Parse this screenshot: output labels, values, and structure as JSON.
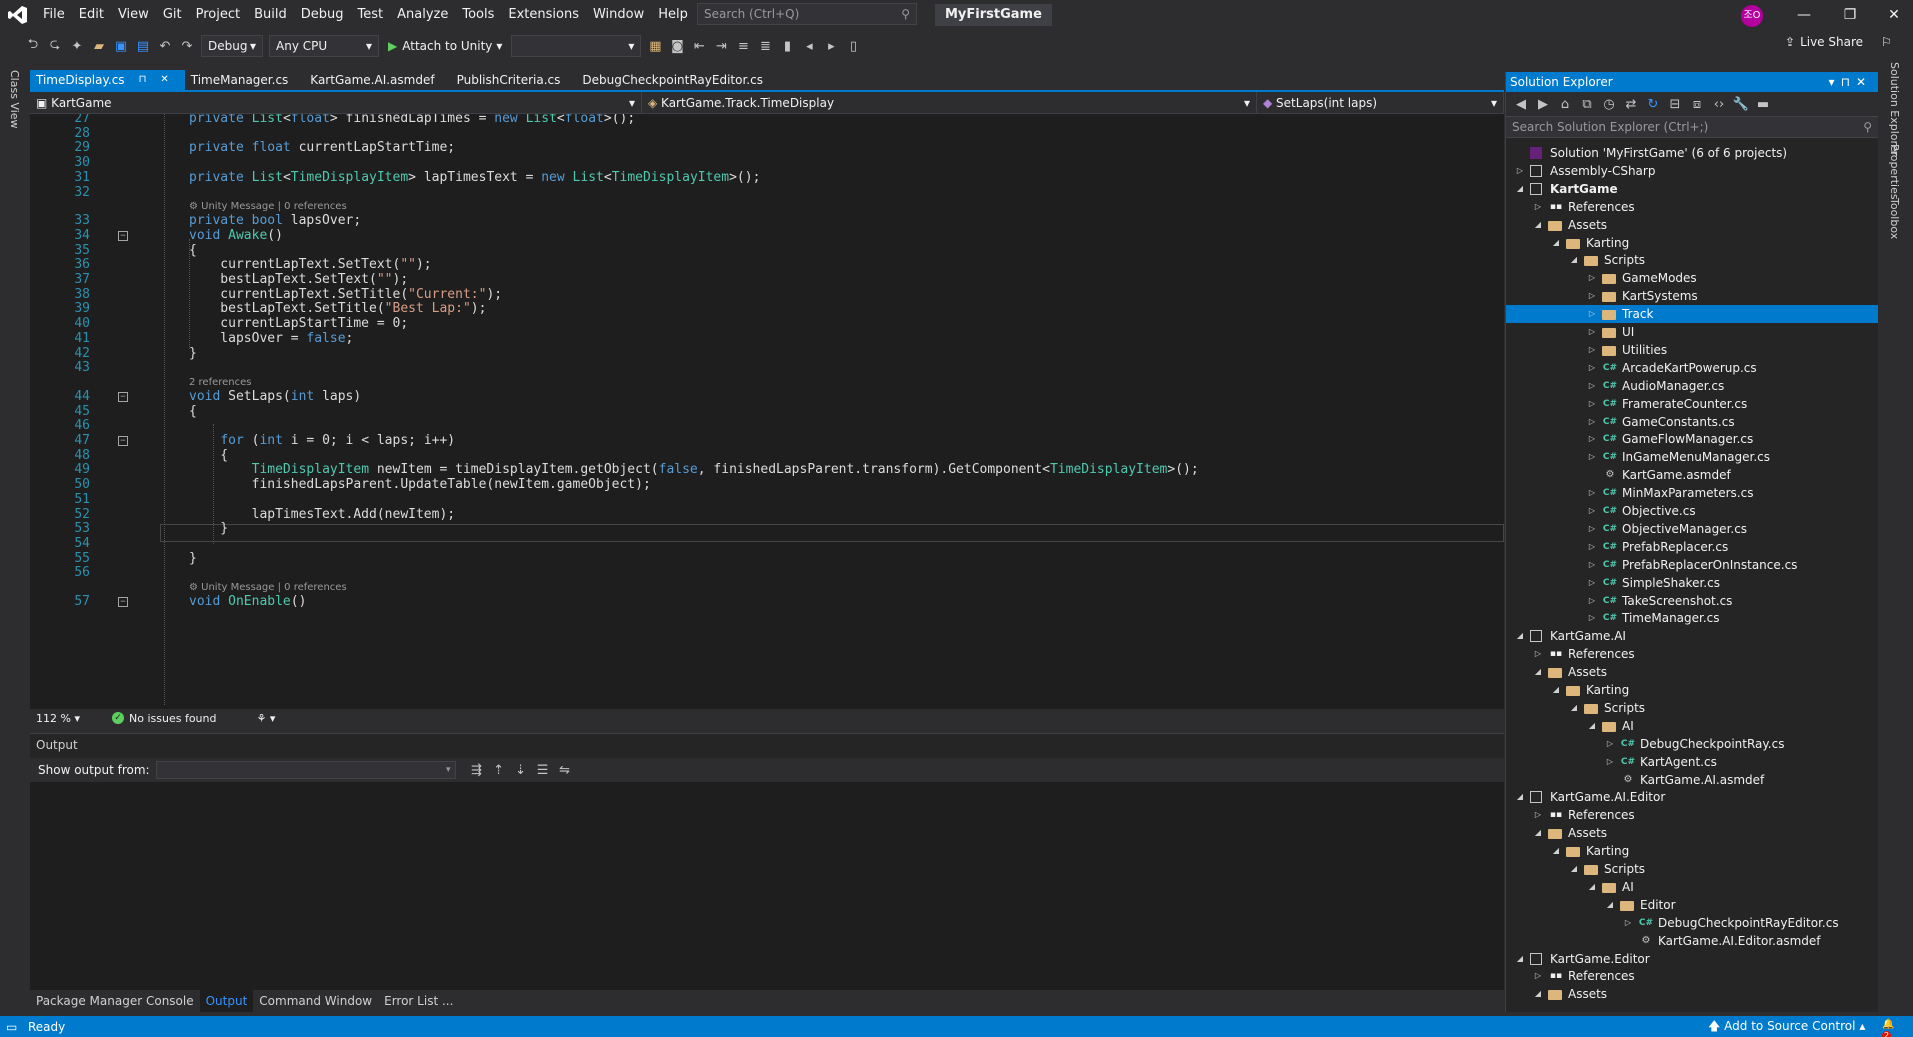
{
  "menubar": {
    "items": [
      "File",
      "Edit",
      "View",
      "Git",
      "Project",
      "Build",
      "Debug",
      "Test",
      "Analyze",
      "Tools",
      "Extensions",
      "Window",
      "Help"
    ],
    "search_placeholder": "Search (Ctrl+Q)",
    "solution_name": "MyFirstGame",
    "avatar_initials": "조O"
  },
  "toolbar": {
    "config": "Debug",
    "platform": "Any CPU",
    "attach_label": "Attach to Unity",
    "live_share": "Live Share"
  },
  "left_strip": {
    "class_view": "Class View"
  },
  "doc_tabs": [
    {
      "label": "TimeDisplay.cs",
      "active": true
    },
    {
      "label": "TimeManager.cs"
    },
    {
      "label": "KartGame.AI.asmdef"
    },
    {
      "label": "PublishCriteria.cs"
    },
    {
      "label": "DebugCheckpointRayEditor.cs"
    }
  ],
  "navbar": {
    "project": "KartGame",
    "class": "KartGame.Track.TimeDisplay",
    "member": "SetLaps(int laps)"
  },
  "editor": {
    "lines": [
      {
        "n": "27",
        "parts": [
          [
            "kw",
            "private "
          ],
          [
            "ty",
            "List"
          ],
          [
            "",
            "<"
          ],
          [
            "kw",
            "float"
          ],
          [
            "",
            "> finishedLapTimes = "
          ],
          [
            "kw",
            "new "
          ],
          [
            "ty",
            "List"
          ],
          [
            "",
            "<"
          ],
          [
            "kw",
            "float"
          ],
          [
            "",
            ">();"
          ]
        ]
      },
      {
        "n": "28",
        "parts": []
      },
      {
        "n": "29",
        "parts": [
          [
            "kw",
            "private float "
          ],
          [
            "",
            "currentLapStartTime;"
          ]
        ]
      },
      {
        "n": "30",
        "parts": []
      },
      {
        "n": "31",
        "parts": [
          [
            "kw",
            "private "
          ],
          [
            "ty",
            "List"
          ],
          [
            "",
            "<"
          ],
          [
            "ty",
            "TimeDisplayItem"
          ],
          [
            "",
            "> lapTimesText = "
          ],
          [
            "kw",
            "new "
          ],
          [
            "ty",
            "List"
          ],
          [
            "",
            "<"
          ],
          [
            "ty",
            "TimeDisplayItem"
          ],
          [
            "",
            ">();"
          ]
        ]
      },
      {
        "n": "32",
        "parts": []
      },
      {
        "n": "33",
        "parts": [
          [
            "kw",
            "private bool "
          ],
          [
            "",
            "lapsOver;"
          ]
        ],
        "lens": "⚙ Unity Message | 0 references"
      },
      {
        "n": "34",
        "parts": [
          [
            "kw",
            "void "
          ],
          [
            "ty",
            "Awake"
          ],
          [
            "",
            "()"
          ]
        ],
        "fold": true
      },
      {
        "n": "35",
        "parts": [
          [
            "",
            "{"
          ]
        ]
      },
      {
        "n": "36",
        "parts": [
          [
            "",
            "    currentLapText.SetText("
          ],
          [
            "st",
            "\"\""
          ],
          [
            "",
            ");"
          ]
        ]
      },
      {
        "n": "37",
        "parts": [
          [
            "",
            "    bestLapText.SetText("
          ],
          [
            "st",
            "\"\""
          ],
          [
            "",
            ");"
          ]
        ]
      },
      {
        "n": "38",
        "parts": [
          [
            "",
            "    currentLapText.SetTitle("
          ],
          [
            "st",
            "\"Current:\""
          ],
          [
            "",
            ");"
          ]
        ]
      },
      {
        "n": "39",
        "parts": [
          [
            "",
            "    bestLapText.SetTitle("
          ],
          [
            "st",
            "\"Best Lap:\""
          ],
          [
            "",
            ");"
          ]
        ]
      },
      {
        "n": "40",
        "parts": [
          [
            "",
            "    currentLapStartTime = 0;"
          ]
        ]
      },
      {
        "n": "41",
        "parts": [
          [
            "",
            "    lapsOver = "
          ],
          [
            "kw",
            "false"
          ],
          [
            "",
            ";"
          ]
        ]
      },
      {
        "n": "42",
        "parts": [
          [
            "",
            "}"
          ]
        ]
      },
      {
        "n": "43",
        "parts": []
      },
      {
        "n": "44",
        "parts": [
          [
            "kw",
            "void "
          ],
          [
            "",
            "SetLaps("
          ],
          [
            "kw",
            "int "
          ],
          [
            "",
            "laps)"
          ]
        ],
        "fold": true,
        "lens": "2 references"
      },
      {
        "n": "45",
        "parts": [
          [
            "",
            "{"
          ]
        ]
      },
      {
        "n": "46",
        "parts": []
      },
      {
        "n": "47",
        "parts": [
          [
            "",
            "    "
          ],
          [
            "kw",
            "for "
          ],
          [
            "",
            "("
          ],
          [
            "kw",
            "int "
          ],
          [
            "",
            "i = 0; i < laps; i++)"
          ]
        ],
        "fold": true
      },
      {
        "n": "48",
        "parts": [
          [
            "",
            "    {"
          ]
        ]
      },
      {
        "n": "49",
        "parts": [
          [
            "",
            "        "
          ],
          [
            "ty",
            "TimeDisplayItem"
          ],
          [
            "",
            " newItem = timeDisplayItem.getObject("
          ],
          [
            "kw",
            "false"
          ],
          [
            "",
            ", finishedLapsParent.transform).GetComponent<"
          ],
          [
            "ty",
            "TimeDisplayItem"
          ],
          [
            "",
            ">();"
          ]
        ]
      },
      {
        "n": "50",
        "parts": [
          [
            "",
            "        finishedLapsParent.UpdateTable(newItem.gameObject);"
          ]
        ]
      },
      {
        "n": "51",
        "parts": []
      },
      {
        "n": "52",
        "parts": [
          [
            "",
            "        lapTimesText.Add(newItem);"
          ]
        ]
      },
      {
        "n": "53",
        "parts": [
          [
            "",
            "    }"
          ]
        ]
      },
      {
        "n": "54",
        "parts": []
      },
      {
        "n": "55",
        "parts": [
          [
            "",
            "}"
          ]
        ]
      },
      {
        "n": "56",
        "parts": []
      },
      {
        "n": "57",
        "parts": [
          [
            "kw",
            "void "
          ],
          [
            "ty",
            "OnEnable"
          ],
          [
            "",
            "()"
          ]
        ],
        "fold": true,
        "lens": "⚙ Unity Message | 0 references"
      }
    ]
  },
  "editor_status": {
    "zoom": "112 %",
    "issues": "No issues found"
  },
  "output": {
    "title": "Output",
    "show_from_label": "Show output from:"
  },
  "bottom_tabs": [
    {
      "label": "Package Manager Console"
    },
    {
      "label": "Output",
      "active": true
    },
    {
      "label": "Command Window"
    },
    {
      "label": "Error List ..."
    }
  ],
  "solution_explorer": {
    "title": "Solution Explorer",
    "search_placeholder": "Search Solution Explorer (Ctrl+;)",
    "tree": [
      {
        "d": 0,
        "tw": "",
        "icon": "sln",
        "label": "Solution 'MyFirstGame' (6 of 6 projects)"
      },
      {
        "d": 0,
        "tw": "▷",
        "icon": "proj",
        "label": "Assembly-CSharp"
      },
      {
        "d": 0,
        "tw": "◢",
        "icon": "proj",
        "label": "KartGame",
        "bold": true
      },
      {
        "d": 1,
        "tw": "▷",
        "icon": "ref",
        "label": "References"
      },
      {
        "d": 1,
        "tw": "◢",
        "icon": "folder",
        "label": "Assets"
      },
      {
        "d": 2,
        "tw": "◢",
        "icon": "folder",
        "label": "Karting"
      },
      {
        "d": 3,
        "tw": "◢",
        "icon": "folder",
        "label": "Scripts"
      },
      {
        "d": 4,
        "tw": "▷",
        "icon": "folder",
        "label": "GameModes"
      },
      {
        "d": 4,
        "tw": "▷",
        "icon": "folder",
        "label": "KartSystems"
      },
      {
        "d": 4,
        "tw": "▷",
        "icon": "folder",
        "label": "Track",
        "selected": true
      },
      {
        "d": 4,
        "tw": "▷",
        "icon": "folder",
        "label": "UI"
      },
      {
        "d": 4,
        "tw": "▷",
        "icon": "folder",
        "label": "Utilities"
      },
      {
        "d": 4,
        "tw": "▷",
        "icon": "cs",
        "label": "ArcadeKartPowerup.cs"
      },
      {
        "d": 4,
        "tw": "▷",
        "icon": "cs",
        "label": "AudioManager.cs"
      },
      {
        "d": 4,
        "tw": "▷",
        "icon": "cs",
        "label": "FramerateCounter.cs"
      },
      {
        "d": 4,
        "tw": "▷",
        "icon": "cs",
        "label": "GameConstants.cs"
      },
      {
        "d": 4,
        "tw": "▷",
        "icon": "cs",
        "label": "GameFlowManager.cs"
      },
      {
        "d": 4,
        "tw": "▷",
        "icon": "cs",
        "label": "InGameMenuManager.cs"
      },
      {
        "d": 4,
        "tw": "",
        "icon": "asm",
        "label": "KartGame.asmdef"
      },
      {
        "d": 4,
        "tw": "▷",
        "icon": "cs",
        "label": "MinMaxParameters.cs"
      },
      {
        "d": 4,
        "tw": "▷",
        "icon": "cs",
        "label": "Objective.cs"
      },
      {
        "d": 4,
        "tw": "▷",
        "icon": "cs",
        "label": "ObjectiveManager.cs"
      },
      {
        "d": 4,
        "tw": "▷",
        "icon": "cs",
        "label": "PrefabReplacer.cs"
      },
      {
        "d": 4,
        "tw": "▷",
        "icon": "cs",
        "label": "PrefabReplacerOnInstance.cs"
      },
      {
        "d": 4,
        "tw": "▷",
        "icon": "cs",
        "label": "SimpleShaker.cs"
      },
      {
        "d": 4,
        "tw": "▷",
        "icon": "cs",
        "label": "TakeScreenshot.cs"
      },
      {
        "d": 4,
        "tw": "▷",
        "icon": "cs",
        "label": "TimeManager.cs"
      },
      {
        "d": 0,
        "tw": "◢",
        "icon": "proj",
        "label": "KartGame.AI"
      },
      {
        "d": 1,
        "tw": "▷",
        "icon": "ref",
        "label": "References"
      },
      {
        "d": 1,
        "tw": "◢",
        "icon": "folder",
        "label": "Assets"
      },
      {
        "d": 2,
        "tw": "◢",
        "icon": "folder",
        "label": "Karting"
      },
      {
        "d": 3,
        "tw": "◢",
        "icon": "folder",
        "label": "Scripts"
      },
      {
        "d": 4,
        "tw": "◢",
        "icon": "folder",
        "label": "AI"
      },
      {
        "d": 5,
        "tw": "▷",
        "icon": "cs",
        "label": "DebugCheckpointRay.cs"
      },
      {
        "d": 5,
        "tw": "▷",
        "icon": "cs",
        "label": "KartAgent.cs"
      },
      {
        "d": 5,
        "tw": "",
        "icon": "asm",
        "label": "KartGame.AI.asmdef"
      },
      {
        "d": 0,
        "tw": "◢",
        "icon": "proj",
        "label": "KartGame.AI.Editor"
      },
      {
        "d": 1,
        "tw": "▷",
        "icon": "ref",
        "label": "References"
      },
      {
        "d": 1,
        "tw": "◢",
        "icon": "folder",
        "label": "Assets"
      },
      {
        "d": 2,
        "tw": "◢",
        "icon": "folder",
        "label": "Karting"
      },
      {
        "d": 3,
        "tw": "◢",
        "icon": "folder",
        "label": "Scripts"
      },
      {
        "d": 4,
        "tw": "◢",
        "icon": "folder",
        "label": "AI"
      },
      {
        "d": 5,
        "tw": "◢",
        "icon": "folder",
        "label": "Editor"
      },
      {
        "d": 6,
        "tw": "▷",
        "icon": "cs",
        "label": "DebugCheckpointRayEditor.cs"
      },
      {
        "d": 6,
        "tw": "",
        "icon": "asm",
        "label": "KartGame.AI.Editor.asmdef"
      },
      {
        "d": 0,
        "tw": "◢",
        "icon": "proj",
        "label": "KartGame.Editor"
      },
      {
        "d": 1,
        "tw": "▷",
        "icon": "ref",
        "label": "References"
      },
      {
        "d": 1,
        "tw": "◢",
        "icon": "folder",
        "label": "Assets"
      }
    ]
  },
  "right_strip": {
    "tabs": [
      "Solution Explorer",
      "Properties",
      "Toolbox"
    ]
  },
  "statusbar": {
    "ready": "Ready",
    "source_control": "Add to Source Control",
    "notifications": "2"
  },
  "colors": {
    "accent": "#007acc",
    "keyword": "#569cd6",
    "type": "#4ec9b0",
    "string": "#d69d85",
    "line_number": "#2b91af"
  }
}
